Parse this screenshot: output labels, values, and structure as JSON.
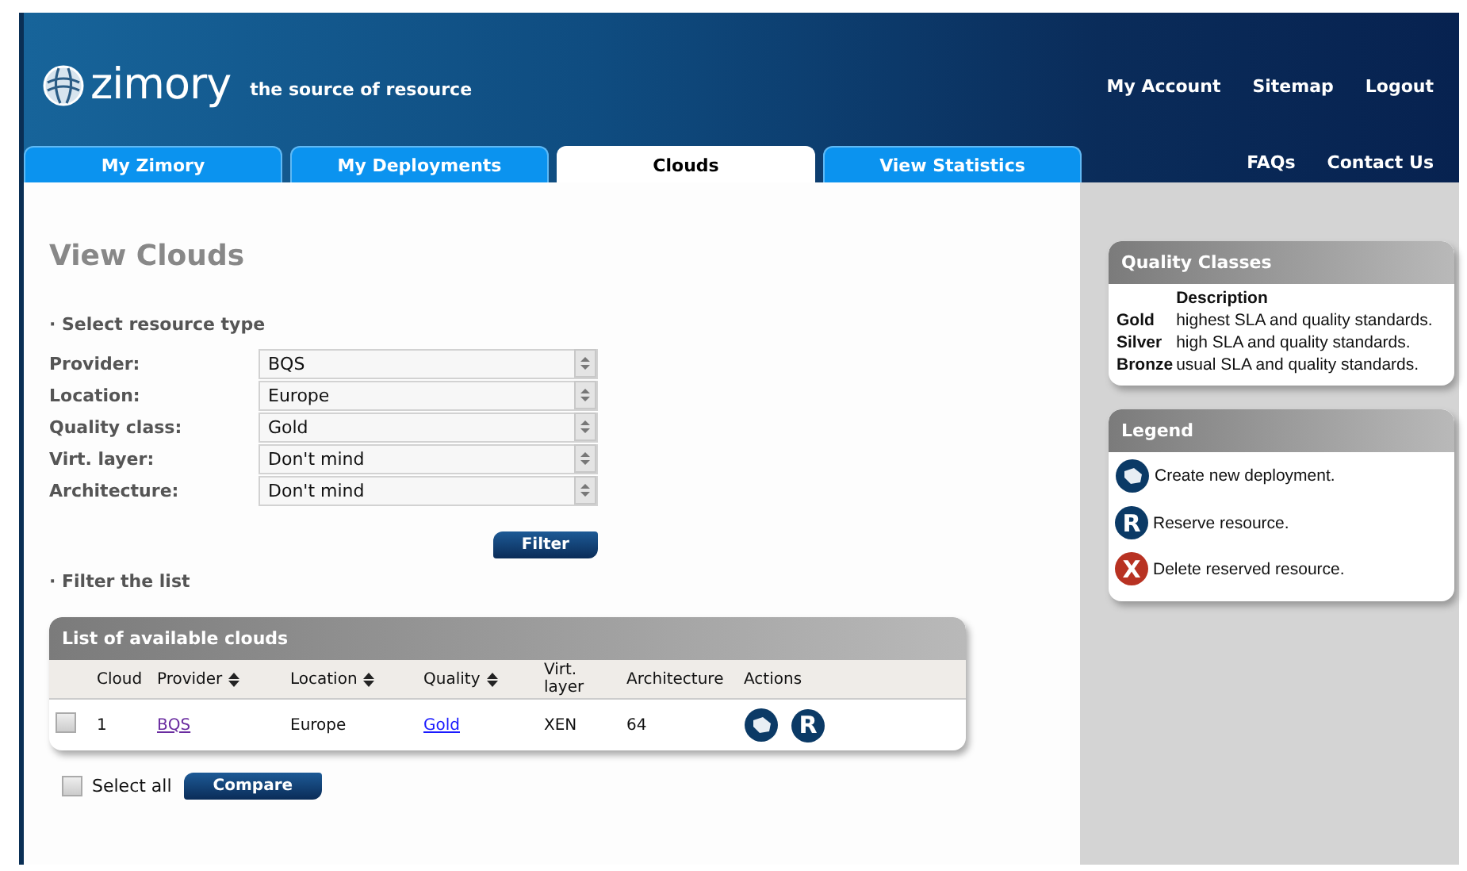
{
  "header": {
    "logo": "zimory",
    "tagline": "the source of resource",
    "links": [
      "My Account",
      "Sitemap",
      "Logout"
    ],
    "sublinks": [
      "FAQs",
      "Contact Us"
    ]
  },
  "tabs": [
    {
      "label": "My Zimory",
      "selected": false
    },
    {
      "label": "My Deployments",
      "selected": false
    },
    {
      "label": "Clouds",
      "selected": true
    },
    {
      "label": "View Statistics",
      "selected": false
    }
  ],
  "page_title": "View Clouds",
  "resource_section": {
    "heading": "· Select resource type",
    "fields": [
      {
        "label": "Provider:",
        "value": "BQS"
      },
      {
        "label": "Location:",
        "value": "Europe"
      },
      {
        "label": "Quality class:",
        "value": "Gold"
      },
      {
        "label": "Virt. layer:",
        "value": "Don't mind"
      },
      {
        "label": "Architecture:",
        "value": "Don't mind"
      }
    ],
    "button": "Filter"
  },
  "filter_section": {
    "heading": "· Filter the list"
  },
  "table": {
    "title": "List of available clouds",
    "columns": [
      {
        "label": "Cloud",
        "sortable": false
      },
      {
        "label": "Provider",
        "sortable": true
      },
      {
        "label": "Location",
        "sortable": true
      },
      {
        "label": "Quality",
        "sortable": true
      },
      {
        "label": "Virt. layer",
        "sortable": false
      },
      {
        "label": "Architecture",
        "sortable": false
      },
      {
        "label": "Actions",
        "sortable": false
      }
    ],
    "rows": [
      {
        "checked": false,
        "cloud": "1",
        "provider": "BQS",
        "provider_visited": true,
        "location": "Europe",
        "quality": "Gold",
        "virt_layer": "XEN",
        "architecture": "64",
        "actions": [
          {
            "kind": "deploy"
          },
          {
            "kind": "reserve",
            "glyph": "R"
          }
        ]
      }
    ]
  },
  "select_all": {
    "label": "Select all",
    "checked": false
  },
  "compare_button": "Compare",
  "quality_classes": {
    "title": "Quality Classes",
    "heading": "Description",
    "rows": [
      {
        "name": "Gold",
        "description": "highest SLA and quality standards."
      },
      {
        "name": "Silver",
        "description": "high SLA and quality standards."
      },
      {
        "name": "Bronze",
        "description": "usual SLA and quality standards."
      }
    ]
  },
  "legend": {
    "title": "Legend",
    "items": [
      {
        "kind": "deploy",
        "text": "Create new deployment."
      },
      {
        "kind": "reserve",
        "glyph": "R",
        "text": "Reserve resource."
      },
      {
        "kind": "delete",
        "glyph": "X",
        "text": "Delete reserved resource."
      }
    ]
  }
}
